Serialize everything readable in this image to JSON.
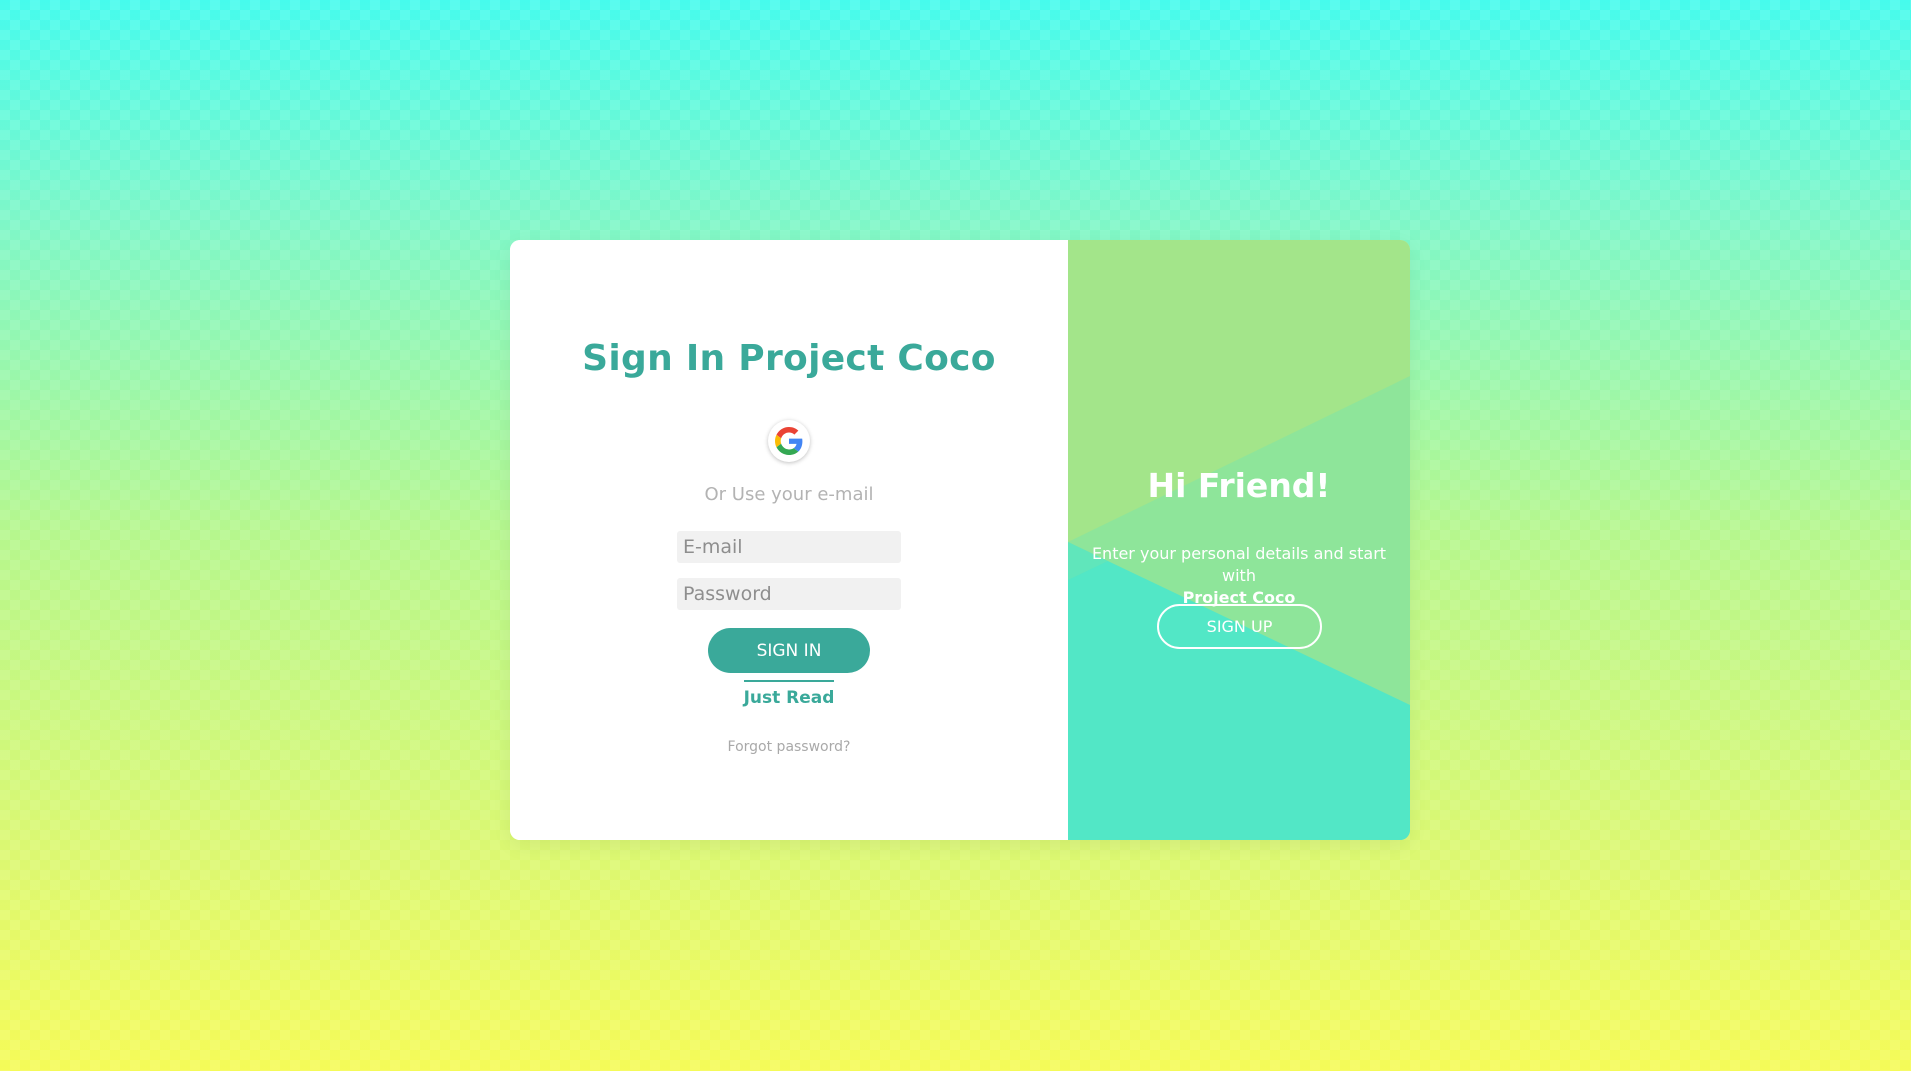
{
  "signin": {
    "title": "Sign In Project Coco",
    "google_icon": "google-g-icon",
    "or_text": "Or Use your e-mail",
    "email_placeholder": "E-mail",
    "password_placeholder": "Password",
    "signin_label": "SIGN IN",
    "just_read_label": "Just Read",
    "forgot_label": "Forgot password?"
  },
  "welcome": {
    "heading": "Hi Friend!",
    "description": "Enter your personal details and start with",
    "brand": "Project Coco",
    "signup_label": "SIGN UP"
  },
  "colors": {
    "accent": "#3aa99a",
    "right_panel_light": "#a3e58a",
    "right_panel_teal": "#52e7c6"
  }
}
